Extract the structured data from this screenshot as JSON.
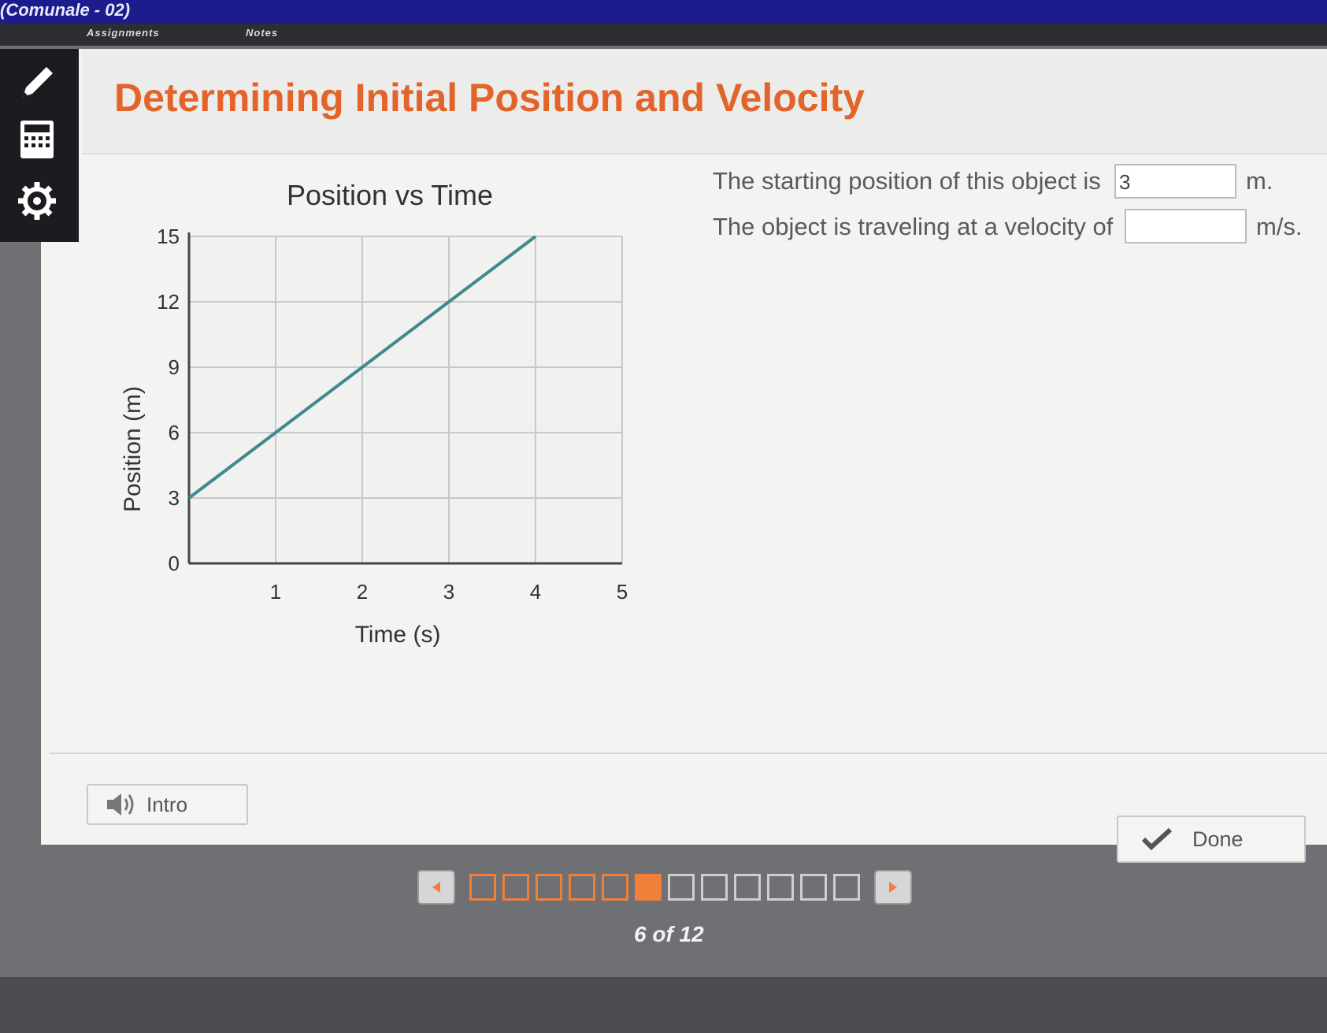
{
  "window": {
    "course_title": "(Comunale - 02)"
  },
  "nav": {
    "crumbs": [
      "Assignments",
      "Notes"
    ],
    "tools": [
      {
        "icon": "pencil-icon"
      },
      {
        "icon": "calculator-icon"
      },
      {
        "icon": "gear-icon"
      }
    ]
  },
  "page": {
    "title": "Determining Initial Position and Velocity"
  },
  "chart_data": {
    "type": "line",
    "title": "Position vs Time",
    "xlabel": "Time (s)",
    "ylabel": "Position (m)",
    "x_ticks": [
      "1",
      "2",
      "3",
      "4",
      "5"
    ],
    "y_ticks": [
      "0",
      "3",
      "6",
      "9",
      "12",
      "15"
    ],
    "xlim": [
      0,
      5
    ],
    "ylim": [
      0,
      15
    ],
    "grid": true,
    "series": [
      {
        "x": [
          0,
          1,
          2,
          3,
          4
        ],
        "y": [
          3,
          6,
          9,
          12,
          15
        ]
      }
    ],
    "line_color": "#3f8a8a"
  },
  "questions": {
    "q1": {
      "prefix": "The starting position of this object is",
      "value": "3",
      "unit": "m."
    },
    "q2": {
      "prefix": "The object is traveling at a velocity of",
      "value": "",
      "unit": "m/s."
    }
  },
  "buttons": {
    "intro_label": "Intro",
    "done_label": "Done"
  },
  "pager": {
    "current": 6,
    "total": 12,
    "label": "6 of 12"
  },
  "colors": {
    "accent": "#e3642a",
    "progress": "#f07f3a"
  }
}
